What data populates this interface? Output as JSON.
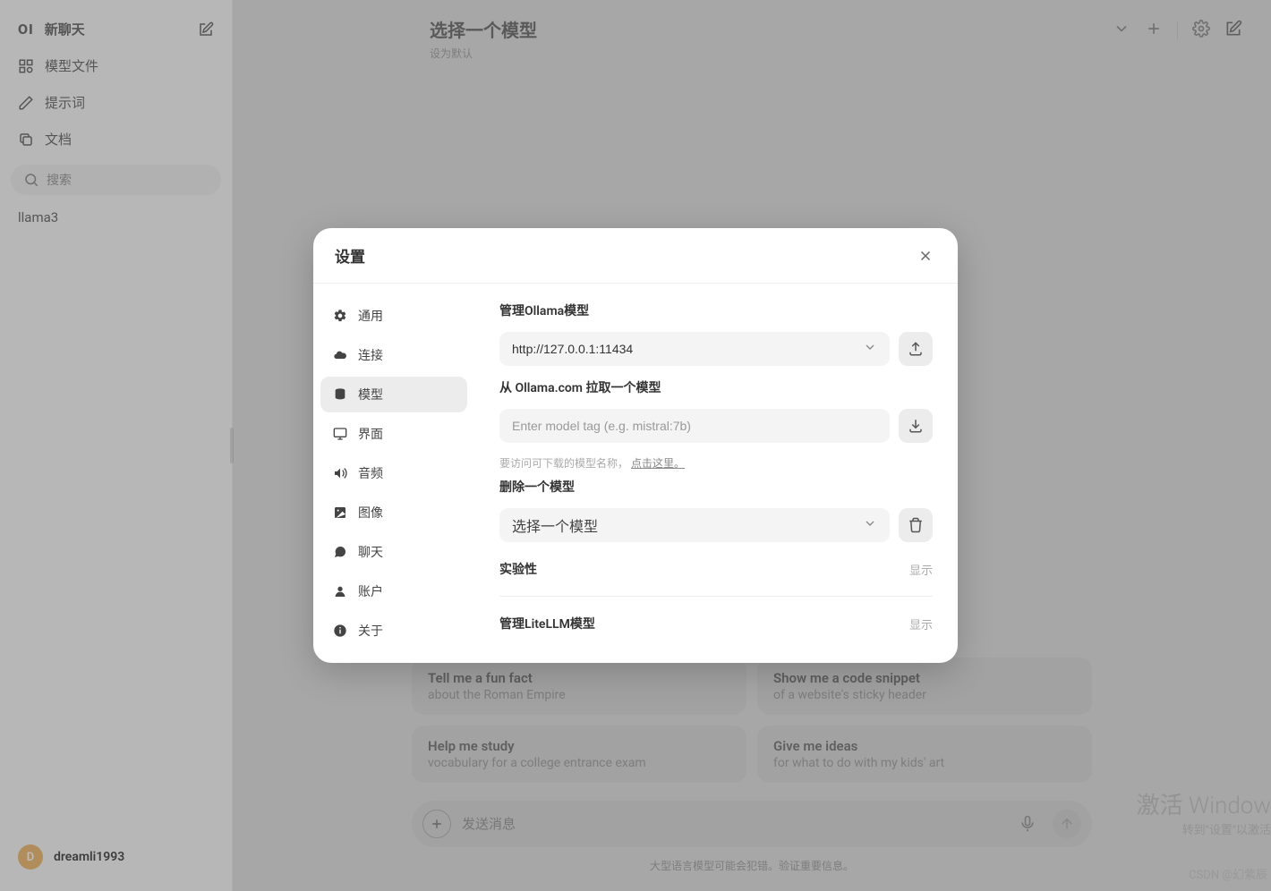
{
  "sidebar": {
    "logo": "OI",
    "new_chat": "新聊天",
    "items": [
      {
        "label": "模型文件"
      },
      {
        "label": "提示词"
      },
      {
        "label": "文档"
      }
    ],
    "search_placeholder": "搜索",
    "models": [
      {
        "label": "llama3"
      }
    ]
  },
  "user": {
    "avatar_letter": "D",
    "name": "dreamli1993"
  },
  "header": {
    "title": "选择一个模型",
    "subtitle": "设为默认"
  },
  "prompts": [
    {
      "title": "Tell me a fun fact",
      "sub": "about the Roman Empire"
    },
    {
      "title": "Show me a code snippet",
      "sub": "of a website's sticky header"
    },
    {
      "title": "Help me study",
      "sub": "vocabulary for a college entrance exam"
    },
    {
      "title": "Give me ideas",
      "sub": "for what to do with my kids' art"
    }
  ],
  "composer": {
    "placeholder": "发送消息"
  },
  "footer": "大型语言模型可能会犯错。验证重要信息。",
  "modal": {
    "title": "设置",
    "nav": [
      {
        "label": "通用"
      },
      {
        "label": "连接"
      },
      {
        "label": "模型"
      },
      {
        "label": "界面"
      },
      {
        "label": "音频"
      },
      {
        "label": "图像"
      },
      {
        "label": "聊天"
      },
      {
        "label": "账户"
      },
      {
        "label": "关于"
      }
    ],
    "pane": {
      "manage_ollama": "管理Ollama模型",
      "ollama_url": "http://127.0.0.1:11434",
      "pull_model": "从 Ollama.com 拉取一个模型",
      "pull_placeholder": "Enter model tag (e.g. mistral:7b)",
      "hint_prefix": "要访问可下载的模型名称，",
      "hint_link": "点击这里。",
      "delete_model": "删除一个模型",
      "delete_placeholder": "选择一个模型",
      "experimental": "实验性",
      "show": "显示",
      "manage_litellm": "管理LiteLLM模型"
    }
  },
  "watermark": {
    "title": "激活 Window",
    "sub": "转到\"设置\"以激活 "
  },
  "csdn": "CSDN @幻紫辰"
}
